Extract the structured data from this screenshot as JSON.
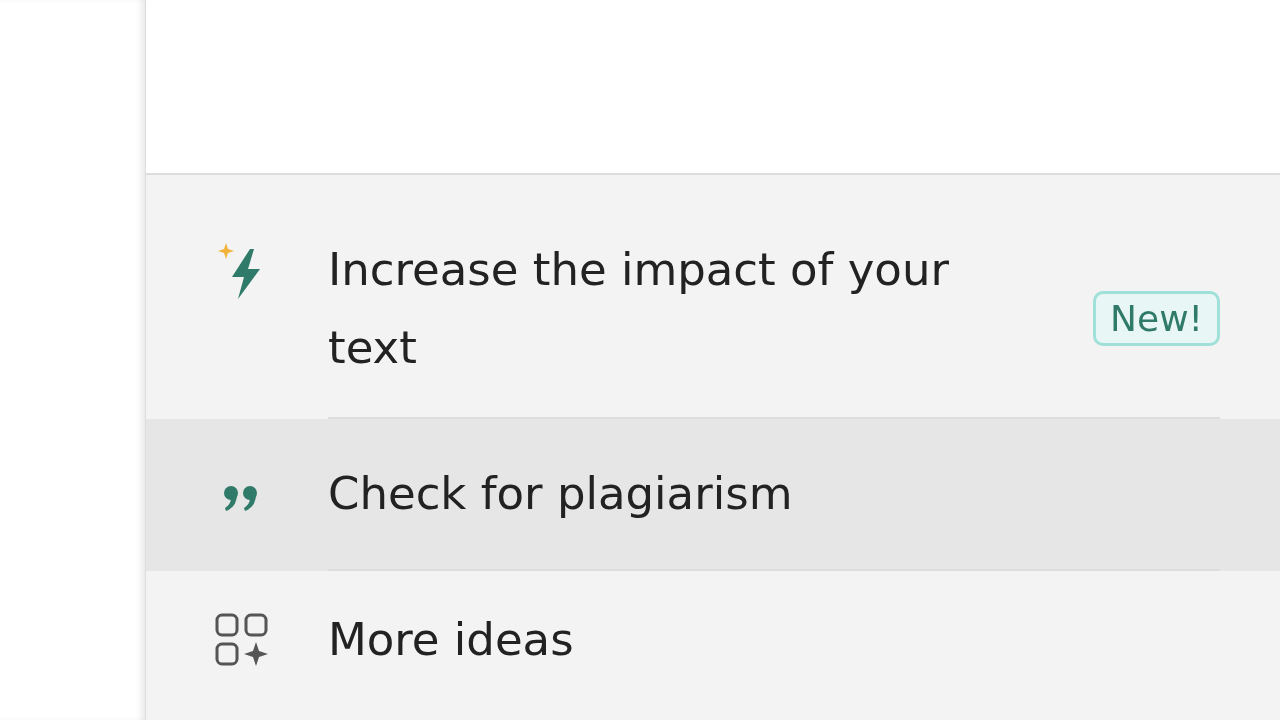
{
  "menu": {
    "items": [
      {
        "kind": "impact",
        "label": "Increase the impact of your text",
        "badge": "New!",
        "selected": false
      },
      {
        "kind": "plagiarism",
        "label": "Check for plagiarism",
        "selected": true
      },
      {
        "kind": "ideas",
        "label": "More ideas",
        "selected": false
      }
    ]
  }
}
